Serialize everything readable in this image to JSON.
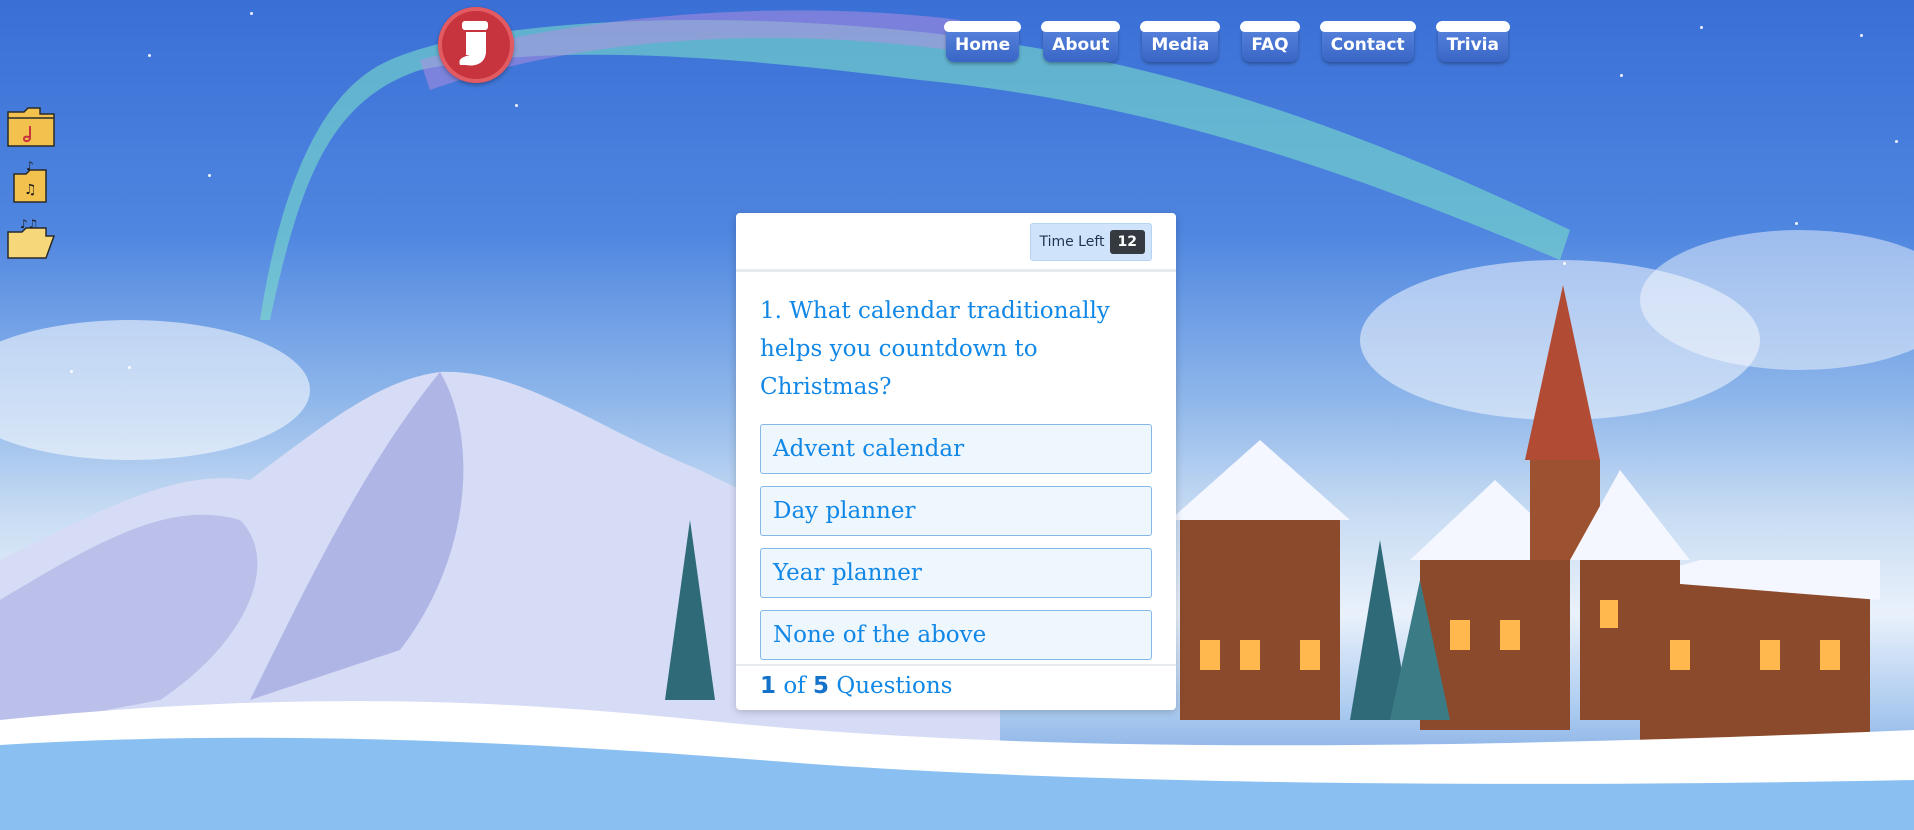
{
  "logo": {
    "icon": "stocking-icon",
    "color": "#c8343e"
  },
  "nav": {
    "items": [
      {
        "label": "Home"
      },
      {
        "label": "About"
      },
      {
        "label": "Media"
      },
      {
        "label": "FAQ"
      },
      {
        "label": "Contact"
      },
      {
        "label": "Trivia"
      }
    ]
  },
  "side": {
    "folders": [
      {
        "icon": "music-folder-icon"
      },
      {
        "icon": "music-folder-icon"
      },
      {
        "icon": "music-folder-open-icon"
      }
    ]
  },
  "quiz": {
    "timer_label": "Time Left",
    "timer_value": "12",
    "question": "1. What calendar traditionally helps you countdown to Christmas?",
    "options": [
      {
        "label": "Advent calendar"
      },
      {
        "label": "Day planner"
      },
      {
        "label": "Year planner"
      },
      {
        "label": "None of the above"
      }
    ],
    "footer": {
      "current": "1",
      "of": "of",
      "total": "5",
      "questions": "Questions"
    }
  },
  "colors": {
    "accent": "#1187e6",
    "nav": "#3966c6",
    "card": "#ffffff"
  }
}
